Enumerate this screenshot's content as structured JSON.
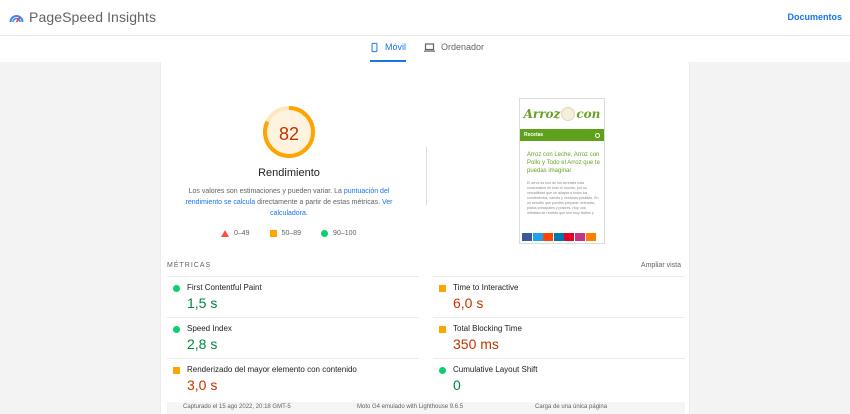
{
  "header": {
    "app_title": "PageSpeed Insights",
    "docs_label": "Documentos"
  },
  "tabs": [
    {
      "label": "Móvil",
      "icon": "phone-icon",
      "active": true
    },
    {
      "label": "Ordenador",
      "icon": "laptop-icon",
      "active": false
    }
  ],
  "performance": {
    "score": "82",
    "score_fraction": 0.82,
    "title": "Rendimiento",
    "desc_start": "Los valores son estimaciones y pueden variar. La",
    "link1": "puntuación del rendimiento se calcula",
    "desc_mid": "directamente a partir de estas métricas.",
    "link2": "Ver calculadora",
    "desc_end": "."
  },
  "legend": [
    {
      "range": "0–49",
      "shape": "triangle",
      "color": "#ff4e42"
    },
    {
      "range": "50–89",
      "shape": "square",
      "color": "#ffa400"
    },
    {
      "range": "90–100",
      "shape": "circle",
      "color": "#0cce6b"
    }
  ],
  "screenshot": {
    "brand_left": "Arroz",
    "brand_right": "con",
    "nav_label": "Recetas",
    "headline": "Arroz con Leche, Arroz con Pollo y Todo el Arroz que te puedas imaginar",
    "body": "El arroz es uno de los cereales más consumidos en todo el mundo, por su versatilidad que se adapta a todos los condimentos, carnes y verduras posibles. En un sencillo que puedes preparar: entradas, platos principales y postres. Hoy una infinidad de recetas que son muy fáciles y",
    "social_colors": [
      "#3b5998",
      "#1da1f2",
      "#ff4500",
      "#0077b5",
      "#e60023",
      "#c13584",
      "#ff7f00"
    ]
  },
  "metrics": {
    "heading": "MÉTRICAS",
    "expand_label": "Ampliar vista",
    "items": [
      {
        "label": "First Contentful Paint",
        "value": "1,5 s",
        "status": "good"
      },
      {
        "label": "Time to Interactive",
        "value": "6,0 s",
        "status": "average"
      },
      {
        "label": "Speed Index",
        "value": "2,8 s",
        "status": "good"
      },
      {
        "label": "Total Blocking Time",
        "value": "350 ms",
        "status": "average"
      },
      {
        "label": "Renderizado del mayor elemento con contenido",
        "value": "3,0 s",
        "status": "average"
      },
      {
        "label": "Cumulative Layout Shift",
        "value": "0",
        "status": "good"
      }
    ]
  },
  "footer_strip": {
    "captured": "Capturado el 15 ago 2022, 20:18 GMT-5",
    "device": "Moto G4 emulado with Lighthouse 9.6.5",
    "session": "Carga de una única página"
  },
  "colors": {
    "accent": "#1a73e8",
    "good": "#0cce6b",
    "average": "#ffa400",
    "poor": "#ff4e42"
  }
}
